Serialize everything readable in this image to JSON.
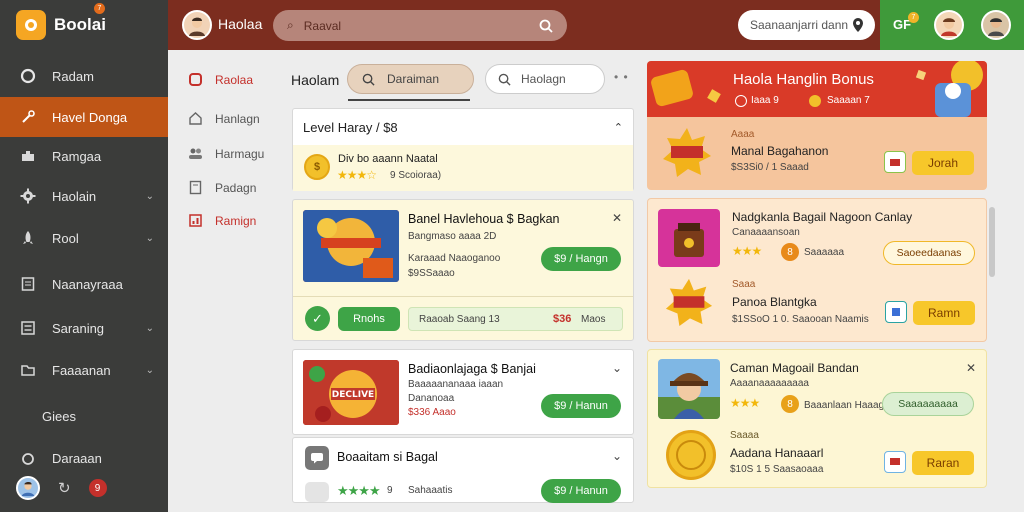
{
  "app": {
    "name": "Boolai",
    "notification": "7"
  },
  "sidebar": {
    "items": [
      {
        "label": "Radam",
        "icon": "circle-icon"
      },
      {
        "label": "Havel Donga",
        "icon": "wrench-icon"
      },
      {
        "label": "Ramgaa",
        "icon": "puzzle-icon"
      },
      {
        "label": "Haolain",
        "icon": "gear-icon"
      },
      {
        "label": "Rool",
        "icon": "rocket-icon"
      },
      {
        "label": "Naanayraaa",
        "icon": "document-icon"
      },
      {
        "label": "Saraning",
        "icon": "list-icon"
      },
      {
        "label": "Faaaanan",
        "icon": "folder-icon"
      },
      {
        "label": "Giees",
        "icon": ""
      },
      {
        "label": "Daraaan",
        "icon": "circle-icon"
      }
    ],
    "bottom": {
      "badge": "9",
      "refresh": "↻"
    }
  },
  "header": {
    "title": "Haolaa",
    "search_placeholder": "Raaval",
    "pill_text": "Saanaanjarri dann",
    "gf_label": "GF",
    "gf_count": "7"
  },
  "subnav": {
    "items": [
      "Raolaa",
      "Hanlagn",
      "Harmagu",
      "Padagn",
      "Ramign"
    ]
  },
  "toolbar": {
    "title": "Haolam",
    "beige_button": "Daraiman",
    "search_placeholder": "Haolagn",
    "more": "• •"
  },
  "cards": {
    "level": {
      "title": "Level Haray / $8",
      "sub_title": "Div bo aaann Naatal",
      "sub_meta": "9 Scoioraa)",
      "stars": "★★★☆"
    },
    "offer1": {
      "title": "Banel Havlehoua $ Bagkan",
      "line1": "Bangmaso aaaa 2D",
      "line2": "Karaaad Naaoganoo",
      "line3": "$9SSaaao",
      "price": "$9 / Hangn",
      "action": "Rnohs",
      "footer_text": "Raaoab Saang 13",
      "footer_price": "$36",
      "footer_unit": "Maos"
    },
    "offer2": {
      "title": "Badiaonlajaga $ Banjai",
      "line1": "Baaaaananaaa iaaan",
      "line2": "Dananoaa",
      "line3": "$336 Aaao",
      "price": "$9 / Hanun",
      "banner_text": "DECLIVE"
    },
    "offer3": {
      "title": "Boaaitam si Bagal",
      "stars": "★★★★",
      "meta": "Sahaaatis",
      "count": "9",
      "price": "$9 / Hanun"
    }
  },
  "promo": {
    "title": "Haola Hanglin Bonus",
    "sub1": "Iaaa 9",
    "sub2": "Saaaan 7",
    "label": "Aaaa",
    "name": "Manal Bagahanon",
    "meta": "$S3Si0 / 1 Saaad",
    "action": "Jorah"
  },
  "deals": {
    "title": "Nadgkanla Bagail Nagoon Canlay",
    "line1": "Canaaaansoan",
    "stars": "★★★",
    "count": "8",
    "sub": "Saaaaaa",
    "chip": "Saoeedaanas",
    "item_label": "Saaa",
    "item_name": "Panoa Blantgka",
    "item_meta": "$1SSoO 1 0. Saaooan Naamis",
    "action": "Ramn"
  },
  "profile": {
    "title": "Caman Magoail Bandan",
    "line1": "Aaaanaaaaaaaaa",
    "stars": "★★★",
    "count": "8",
    "meta": "Baaanlaan Haaag",
    "chip": "Saaaaaaaaa",
    "item_label": "Saaaa",
    "item_name": "Aadana Hanaaarl",
    "item_meta": "$10S 1 5 Saasaoaaa",
    "action": "Raran"
  },
  "colors": {
    "sidebar_bg": "#3b3c3a",
    "active": "#bf5516",
    "header": "#7c2d1f",
    "header_green": "#3f9a3a",
    "accent_green": "#3ea447",
    "accent_yellow": "#f7c72a"
  }
}
